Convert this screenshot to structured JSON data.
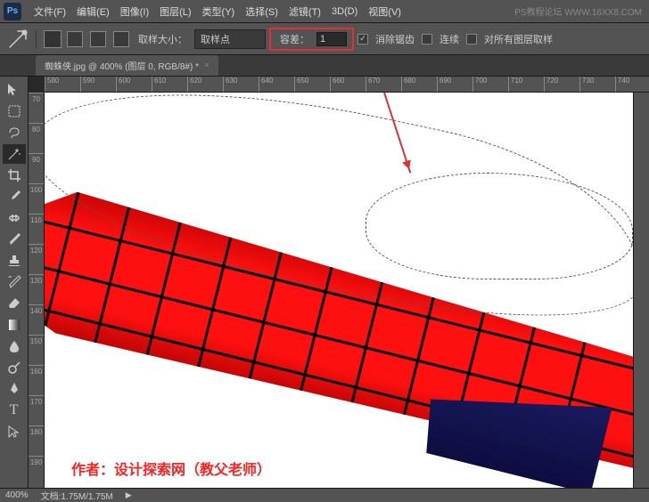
{
  "app": {
    "logo": "Ps"
  },
  "menu": {
    "file": "文件(F)",
    "edit": "编辑(E)",
    "image": "图像(I)",
    "layer": "图层(L)",
    "type": "类型(Y)",
    "select": "选择(S)",
    "filter": "滤镜(T)",
    "threed": "3D(D)",
    "view": "视图(V)"
  },
  "watermark": "PS教程论坛 WWW.16XX8.COM",
  "options": {
    "sample_size_label": "取样大小：",
    "sample_size_value": "取样点",
    "tolerance_label": "容差：",
    "tolerance_value": "1",
    "antialias": "消除锯齿",
    "contiguous": "连续",
    "all_layers": "对所有图层取样"
  },
  "tab": {
    "title": "蜘蛛侠.jpg @ 400% (图层 0, RGB/8#) *",
    "close": "×"
  },
  "hruler_marks": [
    "580",
    "590",
    "600",
    "610",
    "620",
    "630",
    "640",
    "650",
    "660",
    "670",
    "680",
    "690",
    "700",
    "710",
    "720",
    "730",
    "740"
  ],
  "vruler_marks": [
    "70",
    "80",
    "90",
    "100",
    "110",
    "120",
    "130",
    "140",
    "150",
    "160",
    "170",
    "180",
    "190"
  ],
  "credit": "作者：设计探索网（教父老师）",
  "status": {
    "zoom": "400%",
    "doc": "文档:1.75M/1.75M"
  },
  "tools": {
    "move": "move-tool",
    "marquee": "marquee-tool",
    "lasso": "lasso-tool",
    "wand": "magic-wand-tool",
    "crop": "crop-tool",
    "eyedrop": "eyedropper-tool",
    "heal": "healing-tool",
    "brush": "brush-tool",
    "stamp": "stamp-tool",
    "history": "history-brush-tool",
    "eraser": "eraser-tool",
    "gradient": "gradient-tool",
    "blur": "blur-tool",
    "dodge": "dodge-tool",
    "pen": "pen-tool",
    "text": "type-tool",
    "path": "path-tool"
  }
}
